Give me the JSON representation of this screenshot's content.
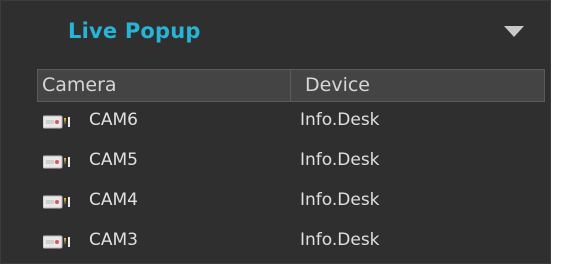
{
  "panel": {
    "title": "Live Popup",
    "collapse_icon": "chevron-down-icon",
    "columns": [
      "Camera",
      "Device"
    ],
    "rows": [
      {
        "camera": "CAM6",
        "device": "Info.Desk",
        "icon": "camera-icon"
      },
      {
        "camera": "CAM5",
        "device": "Info.Desk",
        "icon": "camera-icon"
      },
      {
        "camera": "CAM4",
        "device": "Info.Desk",
        "icon": "camera-icon"
      },
      {
        "camera": "CAM3",
        "device": "Info.Desk",
        "icon": "camera-icon"
      }
    ]
  },
  "colors": {
    "accent": "#27b4d6",
    "panel_bg": "#2f2f2f",
    "header_bg": "#444444",
    "text": "#e0e0e0"
  }
}
